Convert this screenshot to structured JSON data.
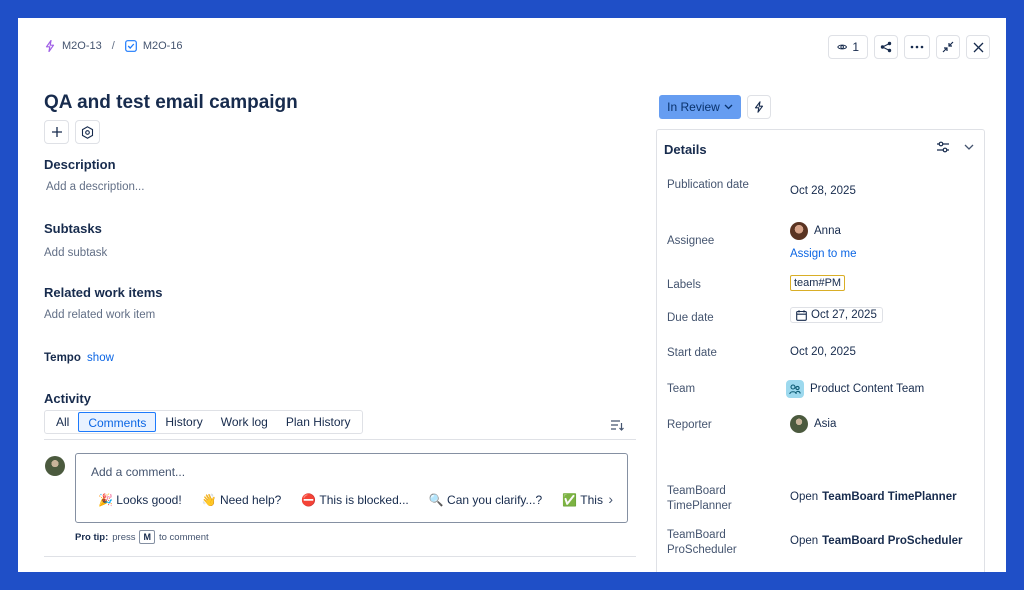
{
  "breadcrumb": {
    "parent": "M2O-13",
    "separator": "/",
    "current": "M2O-16"
  },
  "top_actions": {
    "watch_count": "1"
  },
  "issue": {
    "title": "QA and test email campaign"
  },
  "description": {
    "heading": "Description",
    "placeholder": "Add a description..."
  },
  "subtasks": {
    "heading": "Subtasks",
    "placeholder": "Add subtask"
  },
  "related": {
    "heading": "Related work items",
    "placeholder": "Add related work item"
  },
  "tempo": {
    "label": "Tempo",
    "link": "show"
  },
  "activity": {
    "heading": "Activity",
    "tabs": [
      "All",
      "Comments",
      "History",
      "Work log",
      "Plan History"
    ],
    "active_tab": "Comments",
    "comment_placeholder": "Add a comment...",
    "quick_replies": [
      "🎉 Looks good!",
      "👋 Need help?",
      "⛔ This is blocked...",
      "🔍 Can you clarify...?",
      "✅ This"
    ],
    "protip_label": "Pro tip:",
    "protip_press": "press",
    "protip_key": "M",
    "protip_suffix": "to comment"
  },
  "status": {
    "label": "In Review",
    "color": "#669df1"
  },
  "details": {
    "heading": "Details",
    "publication_date": {
      "label": "Publication date",
      "value": "Oct 28, 2025"
    },
    "assignee": {
      "label": "Assignee",
      "name": "Anna",
      "assign_link": "Assign to me"
    },
    "labels": {
      "label": "Labels",
      "value": "team#PM"
    },
    "due_date": {
      "label": "Due date",
      "value": "Oct 27, 2025"
    },
    "start_date": {
      "label": "Start date",
      "value": "Oct 20, 2025"
    },
    "team": {
      "label": "Team",
      "value": "Product Content Team"
    },
    "reporter": {
      "label": "Reporter",
      "value": "Asia"
    },
    "timeplanner": {
      "label": "TeamBoard TimePlanner",
      "prefix": "Open",
      "value": "TeamBoard TimePlanner"
    },
    "proscheduler": {
      "label": "TeamBoard ProScheduler",
      "prefix": "Open",
      "value": "TeamBoard ProScheduler"
    }
  },
  "colors": {
    "background": "#1f4fc7",
    "link": "#0c66e4",
    "text": "#172b4d"
  }
}
